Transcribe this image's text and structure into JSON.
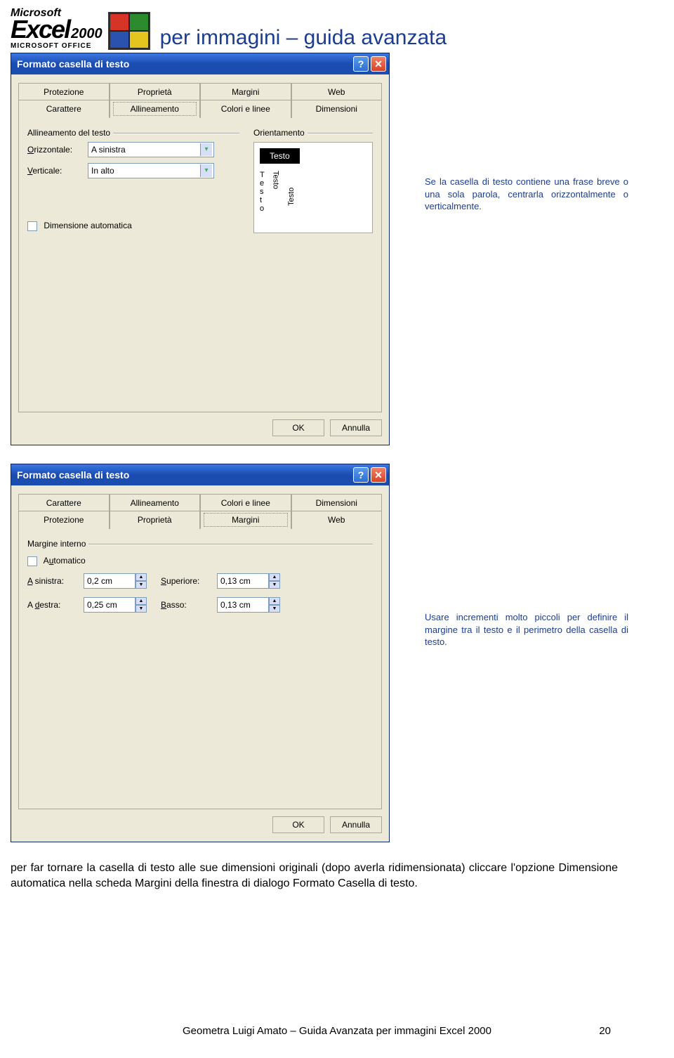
{
  "header": {
    "brand_small": "Microsoft",
    "brand_main": "Excel",
    "brand_year": "2000",
    "office_sub": "MICROSOFT OFFICE",
    "title": "per immagini – guida avanzata"
  },
  "dialog1": {
    "title": "Formato casella di testo",
    "tabs_row1": [
      "Protezione",
      "Proprietà",
      "Margini",
      "Web"
    ],
    "tabs_row2": [
      "Carattere",
      "Allineamento",
      "Colori e linee",
      "Dimensioni"
    ],
    "active_tab": "Allineamento",
    "group_align": "Allineamento del testo",
    "group_orient": "Orientamento",
    "h_label": "Orizzontale:",
    "h_value": "A sinistra",
    "v_label": "Verticale:",
    "v_value": "In alto",
    "orient_text": "Testo",
    "auto_dim": "Dimensione automatica",
    "ok": "OK",
    "cancel": "Annulla"
  },
  "note1": "Se la casella di testo contiene una frase breve o una sola parola, centrarla orizzontalmente o verticalmente.",
  "dialog2": {
    "title": "Formato casella di testo",
    "tabs_row1": [
      "Carattere",
      "Allineamento",
      "Colori e linee",
      "Dimensioni"
    ],
    "tabs_row2": [
      "Protezione",
      "Proprietà",
      "Margini",
      "Web"
    ],
    "active_tab": "Margini",
    "group_margin": "Margine interno",
    "auto_label": "Automatico",
    "left_label": "A sinistra:",
    "left_val": "0,2 cm",
    "top_label": "Superiore:",
    "top_val": "0,13 cm",
    "right_label": "A destra:",
    "right_val": "0,25 cm",
    "bot_label": "Basso:",
    "bot_val": "0,13 cm",
    "ok": "OK",
    "cancel": "Annulla"
  },
  "note2": "Usare incrementi molto piccoli per definire il margine tra il testo e il perimetro della casella di testo.",
  "body_para": "per far tornare la casella di testo alle sue dimensioni originali (dopo averla ridimensionata) cliccare l'opzione Dimensione automatica nella scheda Margini della finestra di dialogo Formato Casella di testo.",
  "footer": {
    "text": "Geometra Luigi Amato – Guida Avanzata per immagini Excel 2000",
    "page": "20"
  }
}
